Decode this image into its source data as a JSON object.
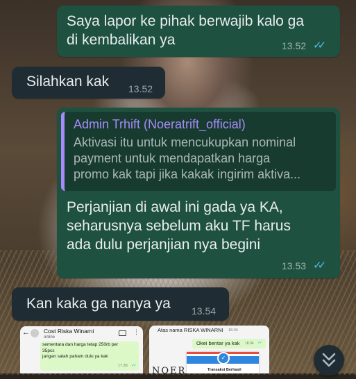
{
  "messages": [
    {
      "text": "Saya lapor ke pihak berwajib kalo ga\ndi kembalikan ya",
      "time": "13.52",
      "ticks": "read-double-check-icon"
    },
    {
      "text": "Silahkan kak",
      "time": "13.52"
    },
    {
      "reply": {
        "name": "Admin Trhift (Noeratrift_official)",
        "text": "Aktivasi itu untuk mencukupkan nominal\npayment untuk mendapatkan harga\npromo kak tapi jika kakak ingirim aktiva..."
      },
      "text": "Perjanjian di awal ini gada ya KA,\nseharusnya sebelum aku TF harus\nada dulu perjanjian nya begini",
      "time": "13.53",
      "ticks": "read-double-check-icon"
    },
    {
      "text": "Kan kaka ga nanya ya",
      "time": "13.54"
    }
  ],
  "thumbnails": [
    {
      "contact": "Cost Riska Winarni",
      "status": "online",
      "bubble_text": "sementara dan harga tetap 250rb per\n35pcs\njangan salah paham dulu ya kak",
      "bubble_time": "17.36"
    },
    {
      "header": "Atas nama RISKA WINARNI",
      "header_time": "18.04",
      "bubble_text": "Okei bentar ya kak",
      "bubble_time": "18.04",
      "footer_text": "Transaksi Berhasil"
    }
  ],
  "colors": {
    "outgoing": "#1f5140",
    "incoming": "#202c33",
    "ticks": "#53bdeb",
    "reply_accent": "#a78bfa"
  },
  "scroll_button_icon": "double-chevron-down-icon"
}
